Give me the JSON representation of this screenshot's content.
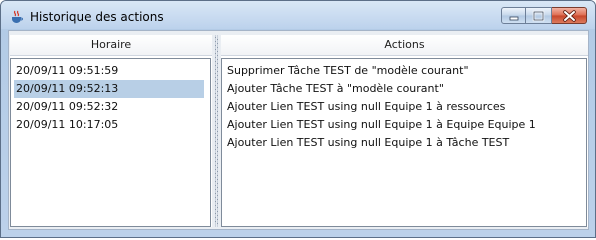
{
  "window": {
    "title": "Historique des actions",
    "icon": "java-cup-icon",
    "controls": [
      "minimize-icon",
      "maximize-icon",
      "close-icon"
    ]
  },
  "left_panel": {
    "header": "Horaire",
    "rows": [
      {
        "time": "20/09/11 09:51:59",
        "selected": false
      },
      {
        "time": "20/09/11 09:52:13",
        "selected": true
      },
      {
        "time": "20/09/11 09:52:32",
        "selected": false
      },
      {
        "time": "20/09/11 10:17:05",
        "selected": false
      }
    ]
  },
  "right_panel": {
    "header": "Actions",
    "rows": [
      "Supprimer  Tâche TEST de \"modèle courant\"",
      "Ajouter Tâche TEST à \"modèle courant\"",
      "Ajouter Lien TEST using null Equipe 1 à ressources",
      "Ajouter Lien TEST using null Equipe 1 à Equipe Equipe 1",
      "Ajouter Lien TEST using null Equipe 1 à Tâche TEST"
    ]
  },
  "colors": {
    "title_bar": "#c7d9ee",
    "selection": "#b8cfe6",
    "close_button": "#d9583b"
  }
}
